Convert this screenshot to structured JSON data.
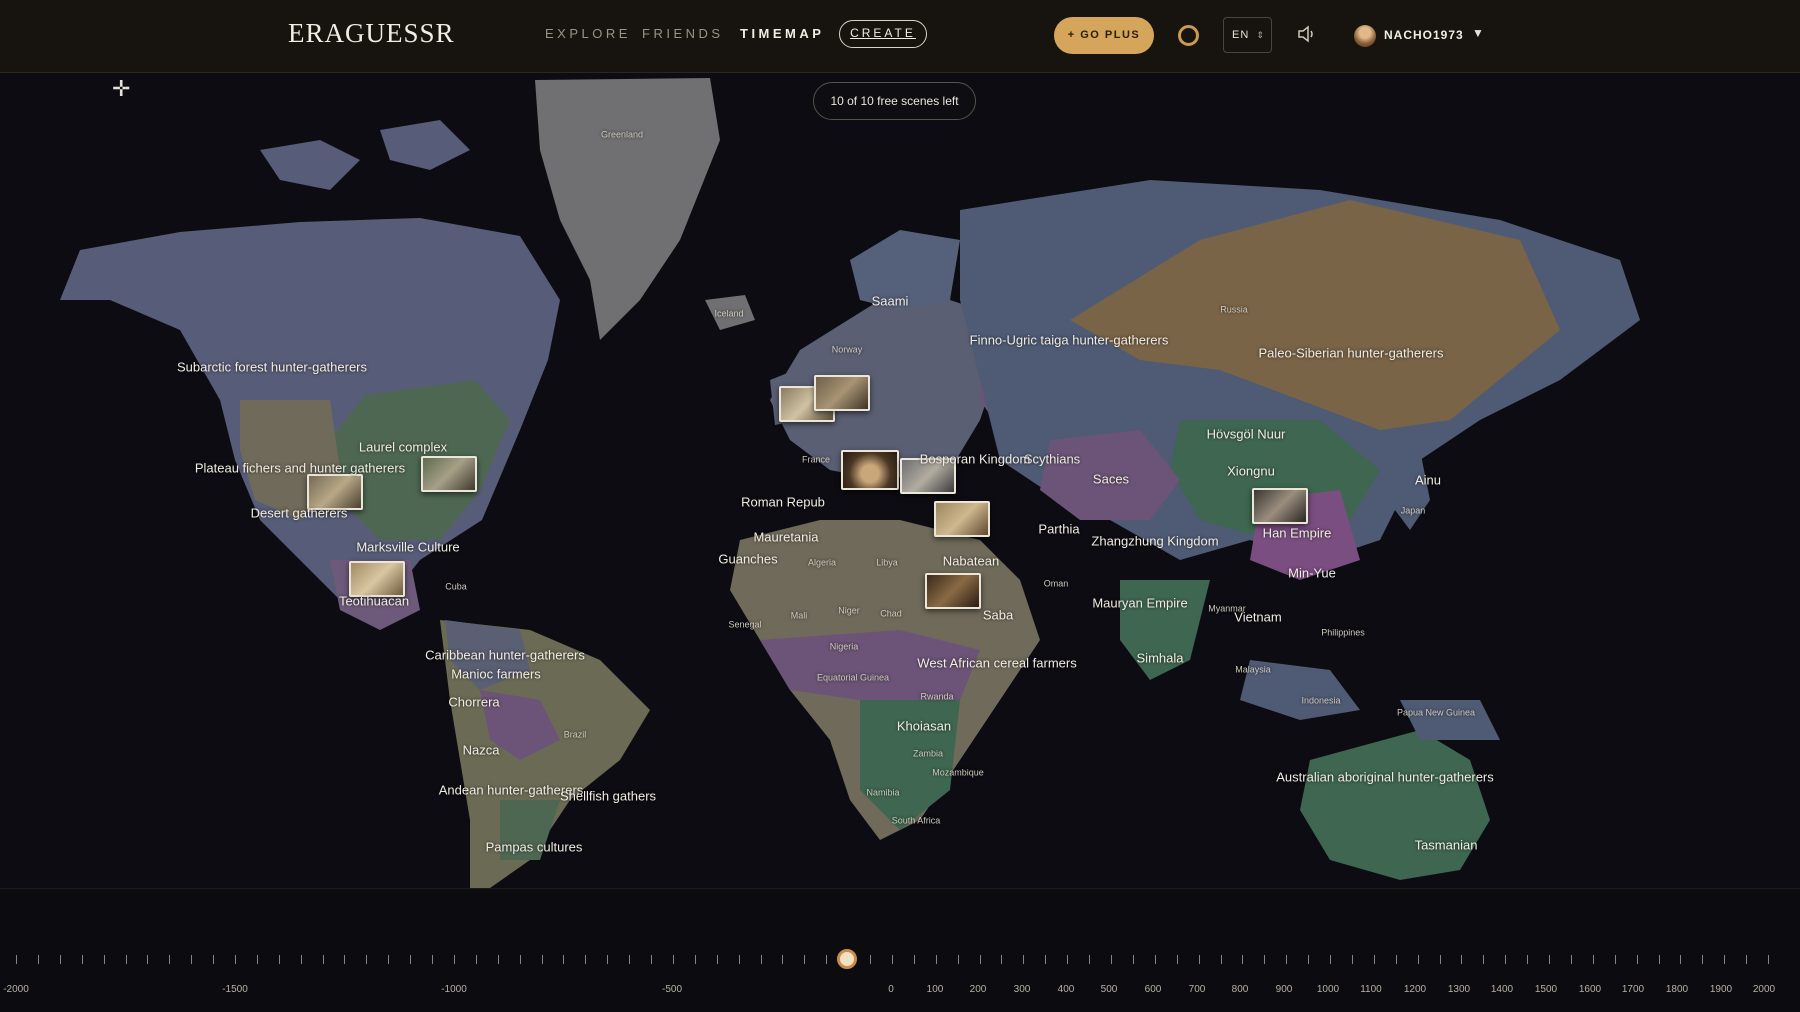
{
  "app": {
    "logo_text": "ERAGUESSR"
  },
  "nav": [
    {
      "label": "EXPLORE"
    },
    {
      "label": "FRIENDS"
    },
    {
      "label": "TIMEMAP"
    },
    {
      "label": "CREATE"
    }
  ],
  "header": {
    "goplus_label": "+ GO PLUS",
    "lang": "EN",
    "username": "NACHO1973"
  },
  "status": {
    "scenes_left": "10 of 10 free scenes left"
  },
  "colors": {
    "accent": "#d4a55a",
    "ocean": "#0c0c12",
    "bar": "#17140f"
  },
  "icons": [
    "crosshair-icon",
    "ring-icon",
    "speaker-icon",
    "chevron-down-icon"
  ],
  "regions": [
    "Subarctic forest hunter-gatherers",
    "Plateau fichers and hunter gatherers",
    "Laurel complex",
    "Desert gatherers",
    "Marksville Culture",
    "Teotihuacan",
    "Caribbean hunter-gatherers",
    "Manioc farmers",
    "Chorrera",
    "Nazca",
    "Andean hunter-gatherers",
    "Shellfish gathers",
    "Pampas cultures",
    "Saami",
    "Finno-Ugric taiga hunter-gatherers",
    "Paleo-Siberian hunter-gatherers",
    "Hövsgöl Nuur",
    "Xiongnu",
    "Ainu",
    "Han Empire",
    "Min-Yue",
    "Vietnam",
    "Scythians",
    "Bosporan Kingdom",
    "Saces",
    "Parthia",
    "Zhangzhung Kingdom",
    "Mauryan Empire",
    "Simhala",
    "Roman Repub",
    "Mauretania",
    "Guanches",
    "Nabatean",
    "Saba",
    "West African cereal farmers",
    "Khoiasan",
    "Australian aboriginal hunter-gatherers",
    "Tasmanian"
  ],
  "places": [
    "Greenland",
    "Iceland",
    "Norway",
    "Russia",
    "France",
    "Algeria",
    "Libya",
    "Mali",
    "Niger",
    "Chad",
    "Nigeria",
    "Japan",
    "Myanmar",
    "Malaysia",
    "Philippines",
    "Indonesia",
    "Papua New Guinea",
    "Brazil",
    "Zambia",
    "Namibia",
    "South Africa",
    "Mozambique",
    "Oman",
    "Senegal",
    "Equatorial Guinea",
    "Rwanda",
    "Cuba"
  ],
  "timeline": {
    "labels": [
      "-2000",
      "-1500",
      "-1000",
      "-500",
      "0",
      "100",
      "200",
      "300",
      "400",
      "500",
      "600",
      "700",
      "800",
      "900",
      "1000",
      "1100",
      "1200",
      "1300",
      "1400",
      "1500",
      "1600",
      "1700",
      "1800",
      "1900",
      "2000"
    ],
    "selected_year": -100
  }
}
